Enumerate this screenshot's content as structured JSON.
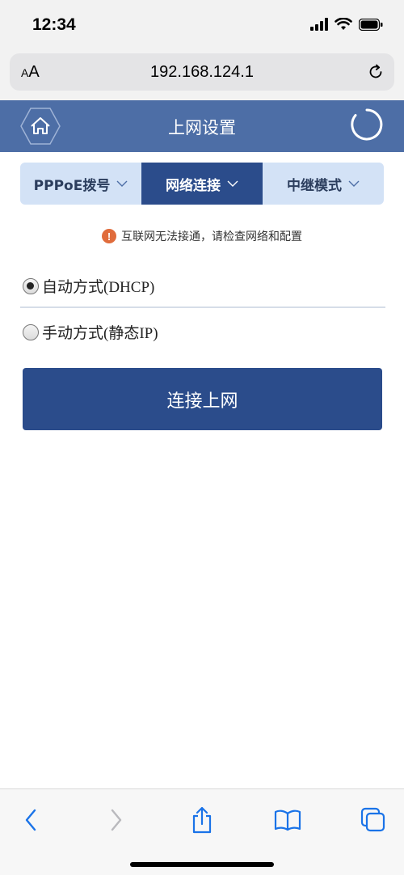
{
  "status_bar": {
    "time": "12:34"
  },
  "browser": {
    "aa_small": "A",
    "aa_large": "A",
    "url": "192.168.124.1"
  },
  "header": {
    "title": "上网设置"
  },
  "tabs": [
    {
      "label": "PPPoE拨号",
      "active": false
    },
    {
      "label": "网络连接",
      "active": true
    },
    {
      "label": "中继模式",
      "active": false
    }
  ],
  "warning": {
    "text": "互联网无法接通，请检查网络和配置",
    "icon_text": "!"
  },
  "options": [
    {
      "label": "自动方式(DHCP)",
      "checked": true
    },
    {
      "label": "手动方式(静态IP)",
      "checked": false
    }
  ],
  "connect_button": {
    "label": "连接上网"
  },
  "colors": {
    "header": "#4d6ea6",
    "accent": "#2b4c8b",
    "tab_bg": "#d3e2f6",
    "warning": "#e06c3c",
    "ios_blue": "#1a73e8"
  }
}
